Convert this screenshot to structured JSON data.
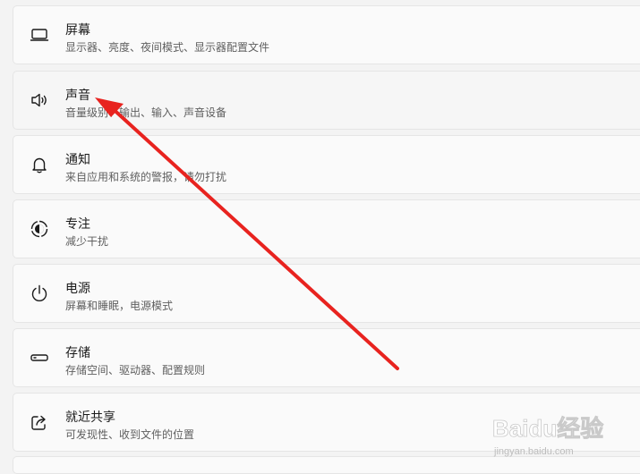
{
  "settings": {
    "items": [
      {
        "title": "屏幕",
        "desc": "显示器、亮度、夜间模式、显示器配置文件",
        "icon": "monitor-icon"
      },
      {
        "title": "声音",
        "desc": "音量级别、输出、输入、声音设备",
        "icon": "speaker-icon"
      },
      {
        "title": "通知",
        "desc": "来自应用和系统的警报，请勿打扰",
        "icon": "bell-icon"
      },
      {
        "title": "专注",
        "desc": "减少干扰",
        "icon": "focus-icon"
      },
      {
        "title": "电源",
        "desc": "屏幕和睡眠，电源模式",
        "icon": "power-icon"
      },
      {
        "title": "存储",
        "desc": "存储空间、驱动器、配置规则",
        "icon": "storage-icon"
      },
      {
        "title": "就近共享",
        "desc": "可发现性、收到文件的位置",
        "icon": "share-icon"
      }
    ]
  },
  "watermark": {
    "brand": "Baidu经验",
    "url": "jingyan.baidu.com"
  },
  "colors": {
    "annotation_arrow": "#e8231f",
    "card_bg": "#fafafa",
    "page_bg": "#f3f3f3"
  }
}
